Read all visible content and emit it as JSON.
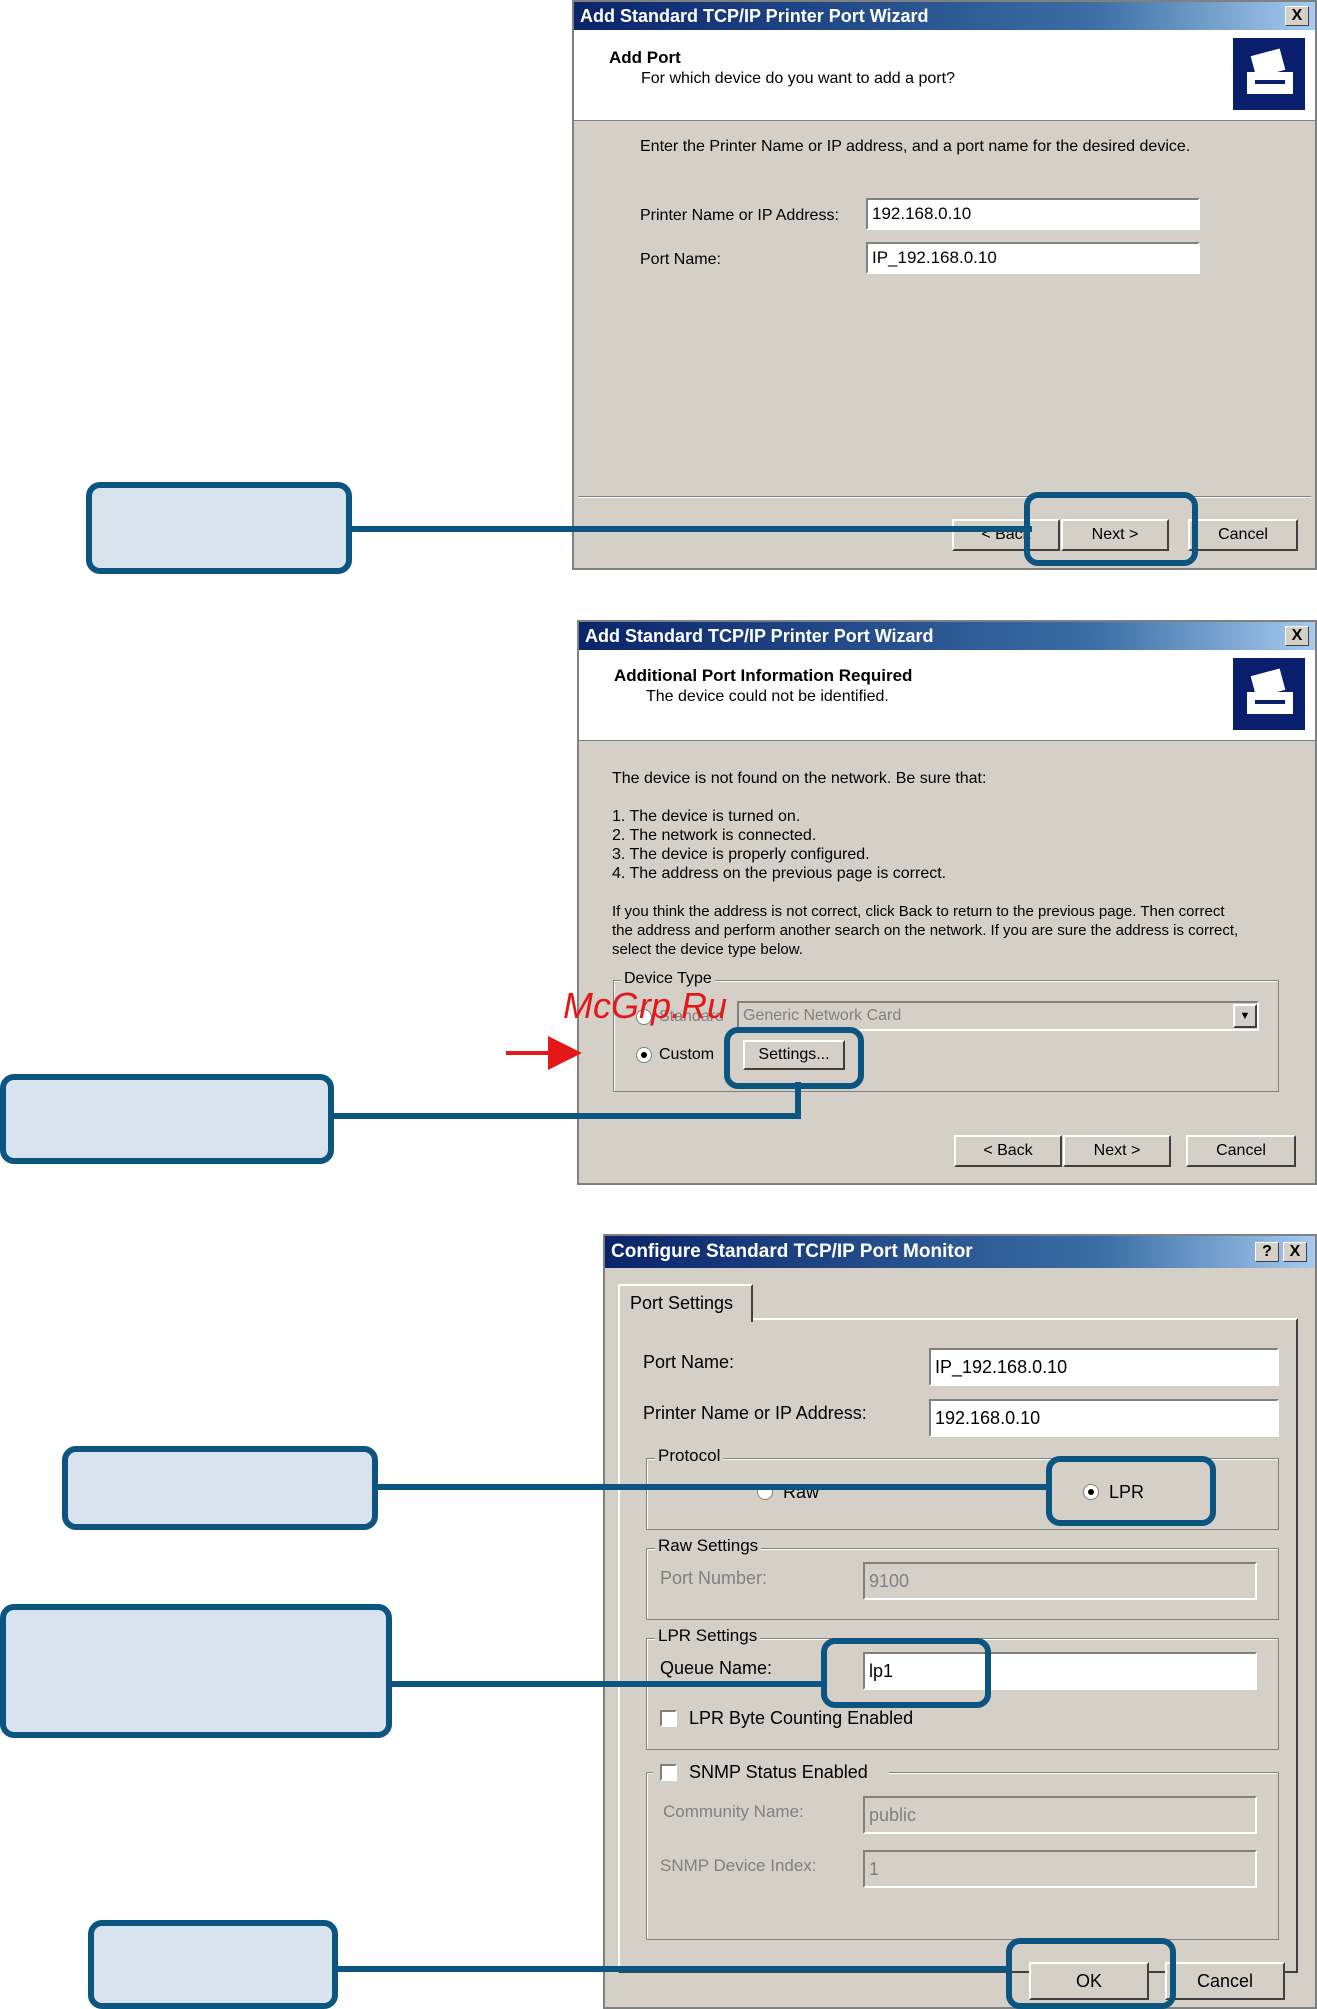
{
  "dialog1": {
    "title": "Add Standard TCP/IP Printer Port Wizard",
    "close": "X",
    "heading": "Add Port",
    "subheading": "For which device do you want to add a port?",
    "instruction": "Enter the Printer Name or IP address, and a port name for the desired device.",
    "printer_label": "Printer Name or IP Address:",
    "printer_value": "192.168.0.10",
    "port_label": "Port Name:",
    "port_value": "IP_192.168.0.10",
    "back": "< Back",
    "next": "Next >",
    "cancel": "Cancel"
  },
  "dialog2": {
    "title": "Add Standard TCP/IP Printer Port Wizard",
    "close": "X",
    "heading": "Additional Port Information Required",
    "subheading": "The device could not be identified.",
    "intro": "The device is not found on the network.  Be sure that:",
    "checklist": [
      "1.   The device is turned on.",
      "2.   The network is connected.",
      "3.   The device is properly configured.",
      "4.   The address on the previous page is correct."
    ],
    "note_lines": [
      "If you think the address is not correct, click Back to return to the previous page.  Then correct",
      "the address and perform another search on the network.  If you are sure the address is correct,",
      "select the device type below."
    ],
    "device_type_label": "Device Type",
    "standard_label": "Standard",
    "standard_value": "Generic Network Card",
    "custom_label": "Custom",
    "settings_button": "Settings...",
    "back": "< Back",
    "next": "Next >",
    "cancel": "Cancel"
  },
  "dialog3": {
    "title": "Configure Standard TCP/IP Port Monitor",
    "help": "?",
    "close": "X",
    "tab": "Port Settings",
    "port_name_label": "Port Name:",
    "port_name_value": "IP_192.168.0.10",
    "printer_label": "Printer Name or IP Address:",
    "printer_value": "192.168.0.10",
    "protocol_label": "Protocol",
    "raw_label": "Raw",
    "lpr_label": "LPR",
    "raw_settings_label": "Raw Settings",
    "port_number_label": "Port Number:",
    "port_number_value": "9100",
    "lpr_settings_label": "LPR Settings",
    "queue_label": "Queue Name:",
    "queue_value": "lp1",
    "byte_counting_label": "LPR Byte Counting Enabled",
    "snmp_label": "SNMP Status Enabled",
    "community_label": "Community Name:",
    "community_value": "public",
    "device_index_label": "SNMP Device Index:",
    "device_index_value": "1",
    "ok": "OK",
    "cancel": "Cancel"
  },
  "watermark": "McGrp.Ru",
  "colors": {
    "callout": "#0b5580",
    "callout_fill": "#d9e3ee",
    "arrow": "#e31818",
    "titlebar": "#0a246a"
  }
}
